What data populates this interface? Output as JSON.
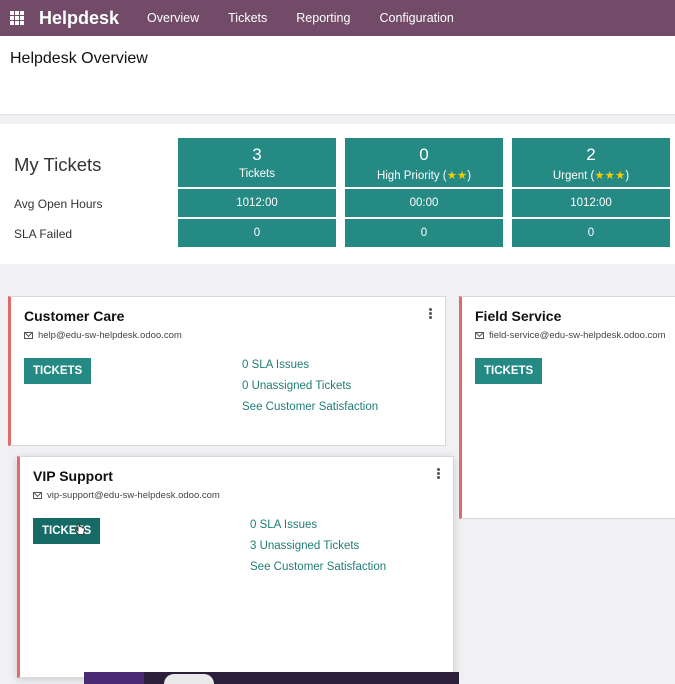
{
  "navbar": {
    "brand": "Helpdesk",
    "items": [
      "Overview",
      "Tickets",
      "Reporting",
      "Configuration"
    ]
  },
  "page": {
    "title": "Helpdesk Overview"
  },
  "my_tickets": {
    "title": "My Tickets",
    "row_labels": [
      "Avg Open Hours",
      "SLA Failed"
    ],
    "columns": [
      {
        "count": "3",
        "label": "Tickets",
        "stars": "",
        "avg_open_hours": "1012:00",
        "sla_failed": "0"
      },
      {
        "count": "0",
        "label": "High Priority (",
        "stars": "★★",
        "label_end": ")",
        "avg_open_hours": "00:00",
        "sla_failed": "0"
      },
      {
        "count": "2",
        "label": "Urgent (",
        "stars": "★★★",
        "label_end": ")",
        "avg_open_hours": "1012:00",
        "sla_failed": "0"
      }
    ]
  },
  "teams": [
    {
      "name": "Customer Care",
      "email": "help@edu-sw-helpdesk.odoo.com",
      "button": "TICKETS",
      "links": [
        "0 SLA Issues",
        "0 Unassigned Tickets",
        "See Customer Satisfaction"
      ]
    },
    {
      "name": "Field Service",
      "email": "field-service@edu-sw-helpdesk.odoo.com",
      "button": "TICKETS",
      "links": []
    },
    {
      "name": "VIP Support",
      "email": "vip-support@edu-sw-helpdesk.odoo.com",
      "button": "TICKETS",
      "links": [
        "0 SLA Issues",
        "3 Unassigned Tickets",
        "See Customer Satisfaction"
      ]
    }
  ],
  "colors": {
    "navbar": "#714b67",
    "accent": "#258a84",
    "card_border": "#e06b6b",
    "star": "#f3cc00"
  }
}
